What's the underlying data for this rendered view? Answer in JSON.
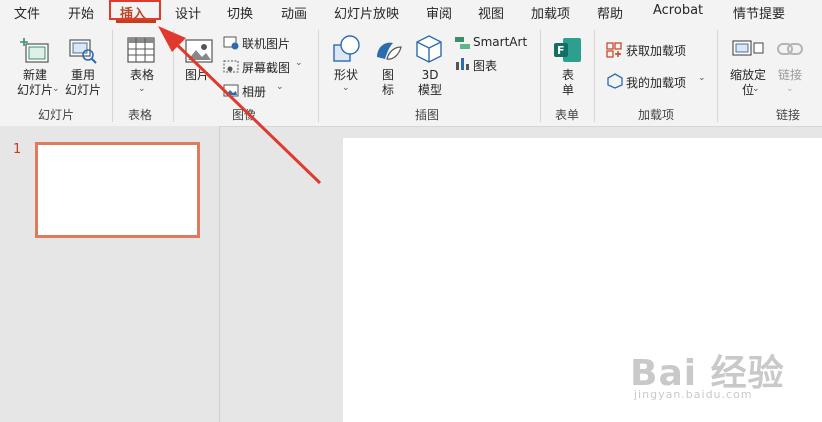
{
  "menu": {
    "tabs": [
      "文件",
      "开始",
      "插入",
      "设计",
      "切换",
      "动画",
      "幻灯片放映",
      "审阅",
      "视图",
      "加载项",
      "帮助",
      "Acrobat",
      "情节提要"
    ],
    "active_tab": "插入"
  },
  "ribbon": {
    "slides": {
      "new_slide": "新建\n幻灯片",
      "reuse_slides": "重用\n幻灯片",
      "group_label": "幻灯片"
    },
    "tables": {
      "table": "表格",
      "group_label": "表格"
    },
    "images": {
      "pictures": "图片",
      "online_pictures": "联机图片",
      "screenshot": "屏幕截图",
      "photo_album": "相册",
      "group_label": "图像"
    },
    "illustrations": {
      "shapes": "形状",
      "icons": "图\n标",
      "models_3d": "3D\n模型",
      "smartart": "SmartArt",
      "chart": "图表",
      "group_label": "插图"
    },
    "forms": {
      "form": "表\n单",
      "group_label": "表单"
    },
    "addins": {
      "get_addins": "获取加载项",
      "my_addins": "我的加载项",
      "group_label": "加载项"
    },
    "links": {
      "zoom": "缩放定\n位",
      "link": "链接",
      "group_label": "链接"
    }
  },
  "thumbnails": {
    "slide_number": "1"
  },
  "watermark": {
    "main": "Bai 经验",
    "sub": "jingyan.baidu.com"
  },
  "colors": {
    "accent": "#c43e1c",
    "annotation": "#e03a2f",
    "thumb_border": "#e07a5f"
  }
}
